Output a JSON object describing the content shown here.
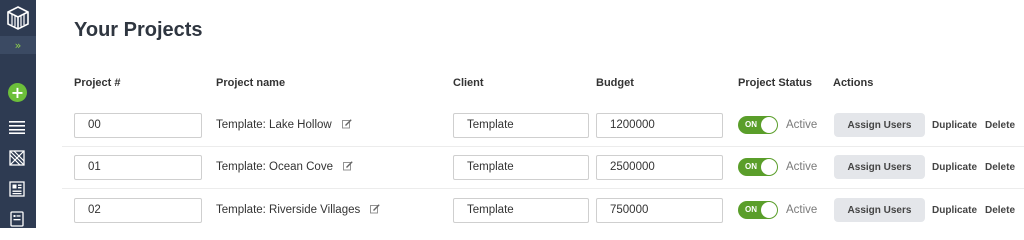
{
  "page_title": "Your Projects",
  "columns": {
    "number": "Project #",
    "name": "Project name",
    "client": "Client",
    "budget": "Budget",
    "status": "Project Status",
    "actions": "Actions"
  },
  "rows": [
    {
      "number": "00",
      "name": "Template: Lake Hollow",
      "client": "Template",
      "budget": "1200000",
      "toggle": "ON",
      "status": "Active",
      "assign": "Assign Users",
      "duplicate": "Duplicate",
      "delete": "Delete"
    },
    {
      "number": "01",
      "name": "Template: Ocean Cove",
      "client": "Template",
      "budget": "2500000",
      "toggle": "ON",
      "status": "Active",
      "assign": "Assign Users",
      "duplicate": "Duplicate",
      "delete": "Delete"
    },
    {
      "number": "02",
      "name": "Template: Riverside Villages",
      "client": "Template",
      "budget": "750000",
      "toggle": "ON",
      "status": "Active",
      "assign": "Assign Users",
      "duplicate": "Duplicate",
      "delete": "Delete"
    }
  ],
  "sidebar": {
    "expand_glyph": "»",
    "add_glyph": "+",
    "icons": [
      "logo-icon",
      "expand-icon",
      "add-icon",
      "list-icon",
      "pattern-icon",
      "dashboard-icon",
      "report-icon"
    ]
  },
  "colors": {
    "sidebar_bg": "#2e3b52",
    "accent_green": "#6cbf3a",
    "toggle_on": "#5a9e2a",
    "button_bg": "#e4e6ea"
  }
}
